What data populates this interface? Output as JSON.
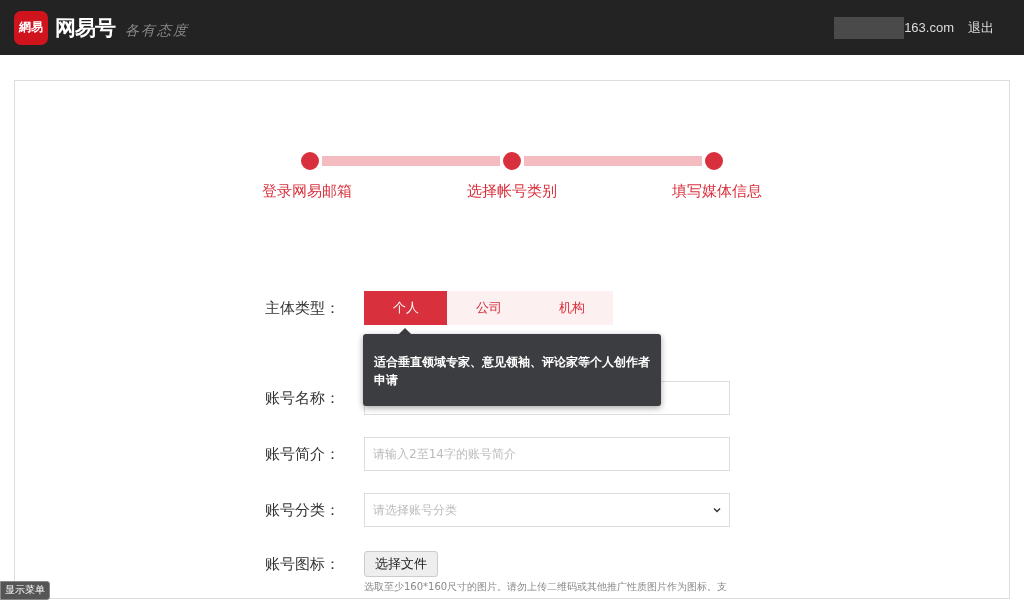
{
  "header": {
    "logo_text": "網易",
    "brand": "网易号",
    "slogan": "各有态度",
    "account": "163.com",
    "logout": "退出"
  },
  "steps": [
    {
      "label": "登录网易邮箱"
    },
    {
      "label": "选择帐号类别"
    },
    {
      "label": "填写媒体信息"
    }
  ],
  "form": {
    "subject_label": "主体类型：",
    "subject_types": [
      {
        "label": "个人",
        "selected": true
      },
      {
        "label": "公司",
        "selected": false
      },
      {
        "label": "机构",
        "selected": false
      }
    ],
    "tooltip": "适合垂直领域专家、意见领袖、评论家等个人创作者申请",
    "fields": [
      {
        "kind": "text",
        "label": "账号名称："
      },
      {
        "kind": "text",
        "label": "账号简介：",
        "placeholder": "请输入2至14字的账号简介"
      },
      {
        "kind": "select",
        "label": "账号分类：",
        "placeholder": "请选择账号分类"
      },
      {
        "kind": "file",
        "label": "账号图标：",
        "button": "选择文件",
        "help": "选取至少160*160尺寸的图片。请勿上传二维码或其他推广性质图片作为图标。支"
      }
    ]
  },
  "menu_badge": "显示菜单"
}
